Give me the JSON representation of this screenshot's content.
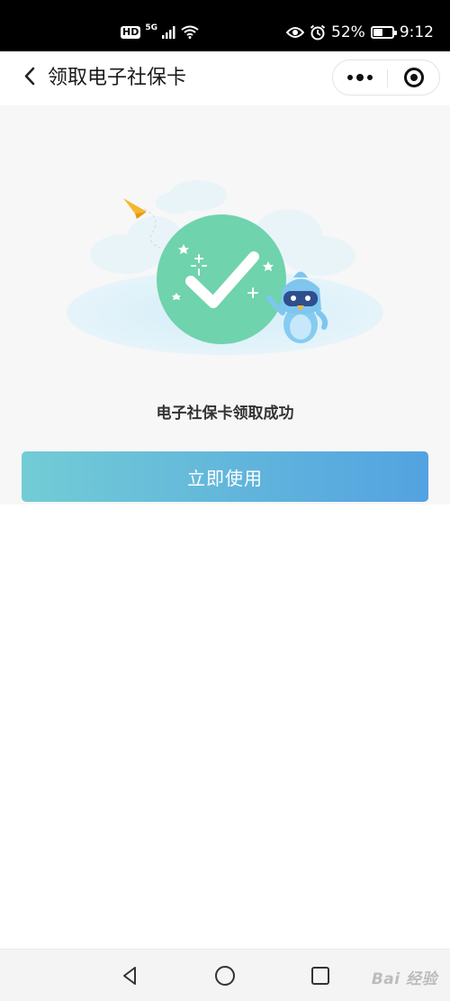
{
  "status_bar": {
    "hd_badge": "HD",
    "network_label": "5G",
    "battery_percent": "52%",
    "battery_level": 0.52,
    "time": "9:12",
    "icons": [
      "signal-icon",
      "wifi-icon",
      "eye-icon",
      "alarm-icon",
      "battery-icon"
    ]
  },
  "nav_bar": {
    "title": "领取电子社保卡",
    "icons": [
      "back-chevron-icon",
      "more-dots-icon",
      "close-target-icon"
    ]
  },
  "content": {
    "success_message": "电子社保卡领取成功",
    "use_button_label": "立即使用",
    "illustration_icons": [
      "checkmark-icon",
      "paper-plane-icon",
      "penguin-mascot-icon",
      "sparkle-icon"
    ]
  },
  "system_nav": {
    "icons": [
      "back-triangle-icon",
      "home-circle-icon",
      "recents-square-icon"
    ],
    "watermark": "Bai 经验"
  },
  "colors": {
    "status_bar_bg": "#000000",
    "content_bg": "#f7f7f7",
    "check_circle": "#6fd3ad",
    "button_gradient_start": "#72ccd5",
    "button_gradient_end": "#53a2e1",
    "mascot_blue": "#7ec6ee",
    "plane_yellow": "#f5b72d"
  }
}
